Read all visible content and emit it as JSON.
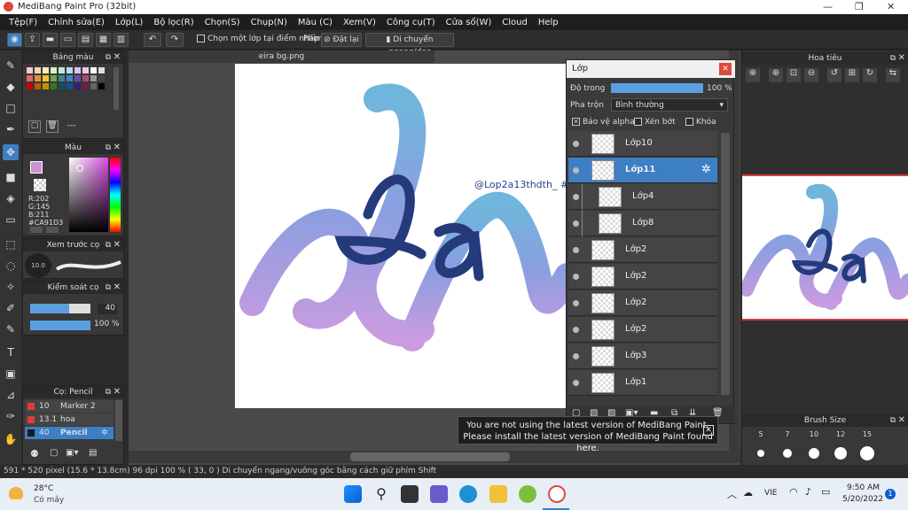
{
  "window": {
    "title": "MediBang Paint Pro (32bit)"
  },
  "menu": [
    "Tệp(F)",
    "Chỉnh sửa(E)",
    "Lớp(L)",
    "Bộ lọc(R)",
    "Chọn(S)",
    "Chụp(N)",
    "Màu (C)",
    "Xem(V)",
    "Công cụ(T)",
    "Cửa sổ(W)",
    "Cloud",
    "Help"
  ],
  "toolbar": {
    "option_label": "Chọn một lớp tại điểm nhấp",
    "phim_label": "Phím",
    "dat_lai": "Đặt lại",
    "di_chuyen": "Di chuyển ngang/dọc"
  },
  "panels": {
    "palette": "Bảng màu",
    "color": "Màu",
    "color_values": {
      "r": "R:202",
      "g": "G:145",
      "b": "B:211",
      "hex": "#CA91D3"
    },
    "brush_preview": "Xem trước cọ",
    "brush_size_preview": "10.0",
    "brush_control": "Kiểm soát cọ",
    "brush_width": "40",
    "brush_opacity": "100 %",
    "brush_list_title": "Cọ: Pencil",
    "brushes": [
      {
        "size": "10",
        "name": "Marker 2",
        "color": "#e03b3b"
      },
      {
        "size": "13.1",
        "name": "hoa",
        "color": "#e03b3b"
      },
      {
        "size": "40",
        "name": "Pencil",
        "color": "#1a1a1a"
      }
    ],
    "palette_more": "---"
  },
  "document": {
    "tab": "eira bg.png",
    "watermark": "@Lop2a13thdth_ #",
    "art_text": "Ja"
  },
  "layers": {
    "title": "Lớp",
    "opacity_label": "Độ trong",
    "opacity_value": "100 %",
    "opacity_fraction": 1.0,
    "blend_label": "Pha trộn",
    "blend_value": "Bình thường",
    "protect_alpha": "Bảo vệ alpha",
    "clip": "Xén bớt",
    "lock": "Khóa",
    "items": [
      {
        "name": "Lớp10",
        "selected": false,
        "indent": false
      },
      {
        "name": "Lớp11",
        "selected": true,
        "indent": false
      },
      {
        "name": "Lớp4",
        "selected": false,
        "indent": true
      },
      {
        "name": "Lớp8",
        "selected": false,
        "indent": true
      },
      {
        "name": "Lớp2",
        "selected": false,
        "indent": false
      },
      {
        "name": "Lớp2",
        "selected": false,
        "indent": false
      },
      {
        "name": "Lớp2",
        "selected": false,
        "indent": false
      },
      {
        "name": "Lớp2",
        "selected": false,
        "indent": false
      },
      {
        "name": "Lớp3",
        "selected": false,
        "indent": false
      },
      {
        "name": "Lớp1",
        "selected": false,
        "indent": false
      }
    ]
  },
  "navigator": {
    "title": "Hoa tiêu"
  },
  "brush_size": {
    "title": "Brush Size",
    "sizes": [
      "5",
      "7",
      "10",
      "12",
      "15"
    ]
  },
  "notice": {
    "line1": "You are not using the latest version of MediBang Paint.",
    "line2": "Please install the latest version of MediBang Paint found here."
  },
  "status": {
    "text": "591 * 520 pixel   (15.6 * 13.8cm)   96 dpi   100 %   ( 33, 0 )   Di chuyển ngang/vuông góc bằng cách giữ phím Shift"
  },
  "taskbar": {
    "weather_temp": "28°C",
    "weather_desc": "Có mây",
    "lang": "VIE",
    "time": "9:50 AM",
    "date": "5/20/2022",
    "badge": "1"
  },
  "colors": {
    "accent": "#3d7fc4",
    "gradient_top": "#6fb6dc",
    "gradient_bottom": "#c99be0"
  }
}
